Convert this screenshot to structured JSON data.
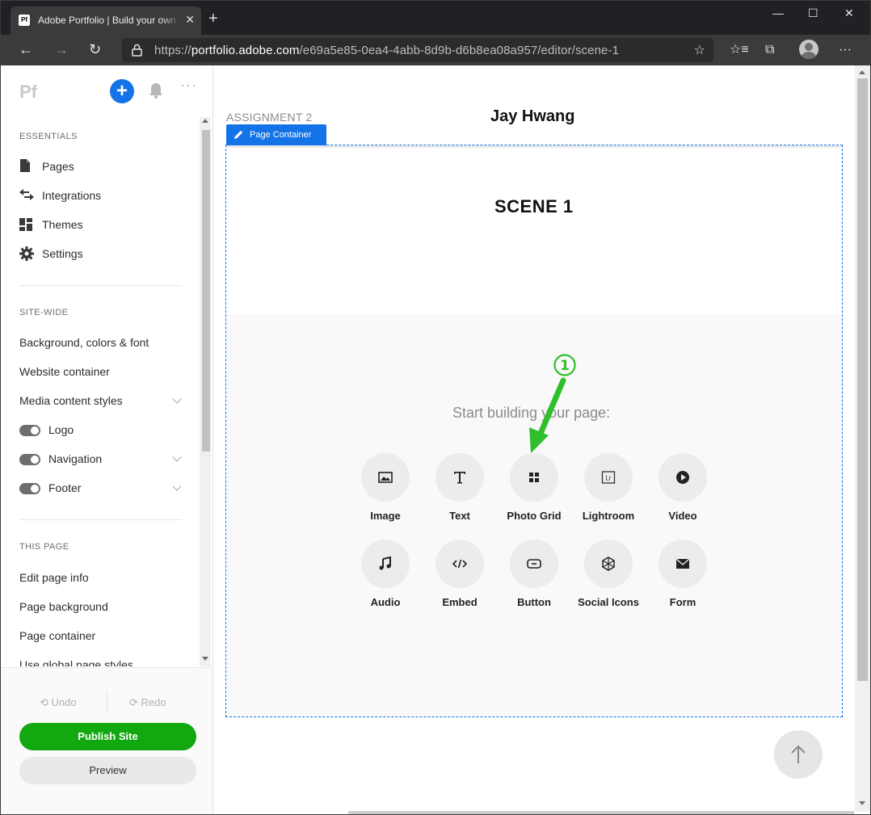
{
  "colors": {
    "accent": "#1473e6",
    "publish": "#12a80f",
    "annotation": "#2fbf2c"
  },
  "browser": {
    "tab_title": "Adobe Portfolio | Build your own",
    "tab_favicon": "Pf",
    "url_prefix": "https://",
    "url_host": "portfolio.adobe.com",
    "url_path": "/e69a5e85-0ea4-4abb-8d9b-d6b8ea08a957/editor/scene-1"
  },
  "sidebar": {
    "logo": "Pf",
    "essentials_heading": "ESSENTIALS",
    "essentials": [
      {
        "label": "Pages",
        "icon": "page-icon"
      },
      {
        "label": "Integrations",
        "icon": "integrations-icon"
      },
      {
        "label": "Themes",
        "icon": "themes-icon"
      },
      {
        "label": "Settings",
        "icon": "gear-icon"
      }
    ],
    "sitewide_heading": "SITE-WIDE",
    "sitewide": [
      "Background, colors & font",
      "Website container",
      "Media content styles",
      "Logo",
      "Navigation",
      "Footer"
    ],
    "thispage_heading": "THIS PAGE",
    "thispage": [
      "Edit page info",
      "Page background",
      "Page container",
      "Use global page styles"
    ],
    "undo_label": "Undo",
    "redo_label": "Redo",
    "publish_label": "Publish Site",
    "preview_label": "Preview"
  },
  "canvas": {
    "assignment": "ASSIGNMENT 2",
    "site_name": "Jay Hwang",
    "page_container_label": "Page Container",
    "scene_title": "SCENE 1",
    "start_text": "Start building your page:",
    "annotation_number": "1",
    "tiles": [
      {
        "label": "Image",
        "icon": "image-icon"
      },
      {
        "label": "Text",
        "icon": "text-icon"
      },
      {
        "label": "Photo Grid",
        "icon": "photo-grid-icon"
      },
      {
        "label": "Lightroom",
        "icon": "lightroom-icon"
      },
      {
        "label": "Video",
        "icon": "video-icon"
      },
      {
        "label": "Audio",
        "icon": "audio-icon"
      },
      {
        "label": "Embed",
        "icon": "embed-icon"
      },
      {
        "label": "Button",
        "icon": "button-icon"
      },
      {
        "label": "Social Icons",
        "icon": "social-icons-icon"
      },
      {
        "label": "Form",
        "icon": "form-icon"
      }
    ]
  }
}
